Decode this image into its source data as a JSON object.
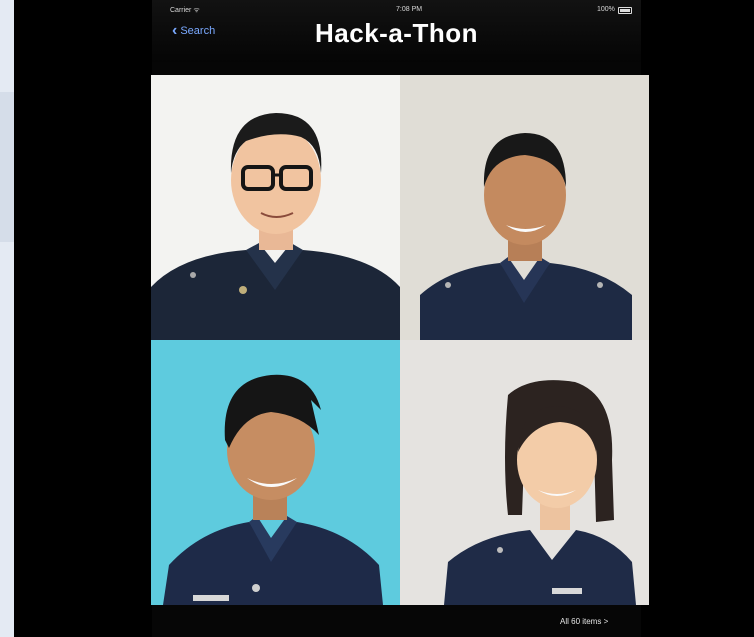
{
  "status_bar": {
    "carrier": "Carrier ᯤ",
    "time": "7:08 PM",
    "battery": "100%"
  },
  "nav": {
    "back_label": "Search",
    "title": "Hack-a-Thon"
  },
  "photos": [
    {
      "icon": "portrait-photo"
    },
    {
      "icon": "portrait-photo"
    },
    {
      "icon": "portrait-photo"
    },
    {
      "icon": "portrait-photo"
    }
  ],
  "footer": {
    "items_link": "All 60 items >"
  }
}
